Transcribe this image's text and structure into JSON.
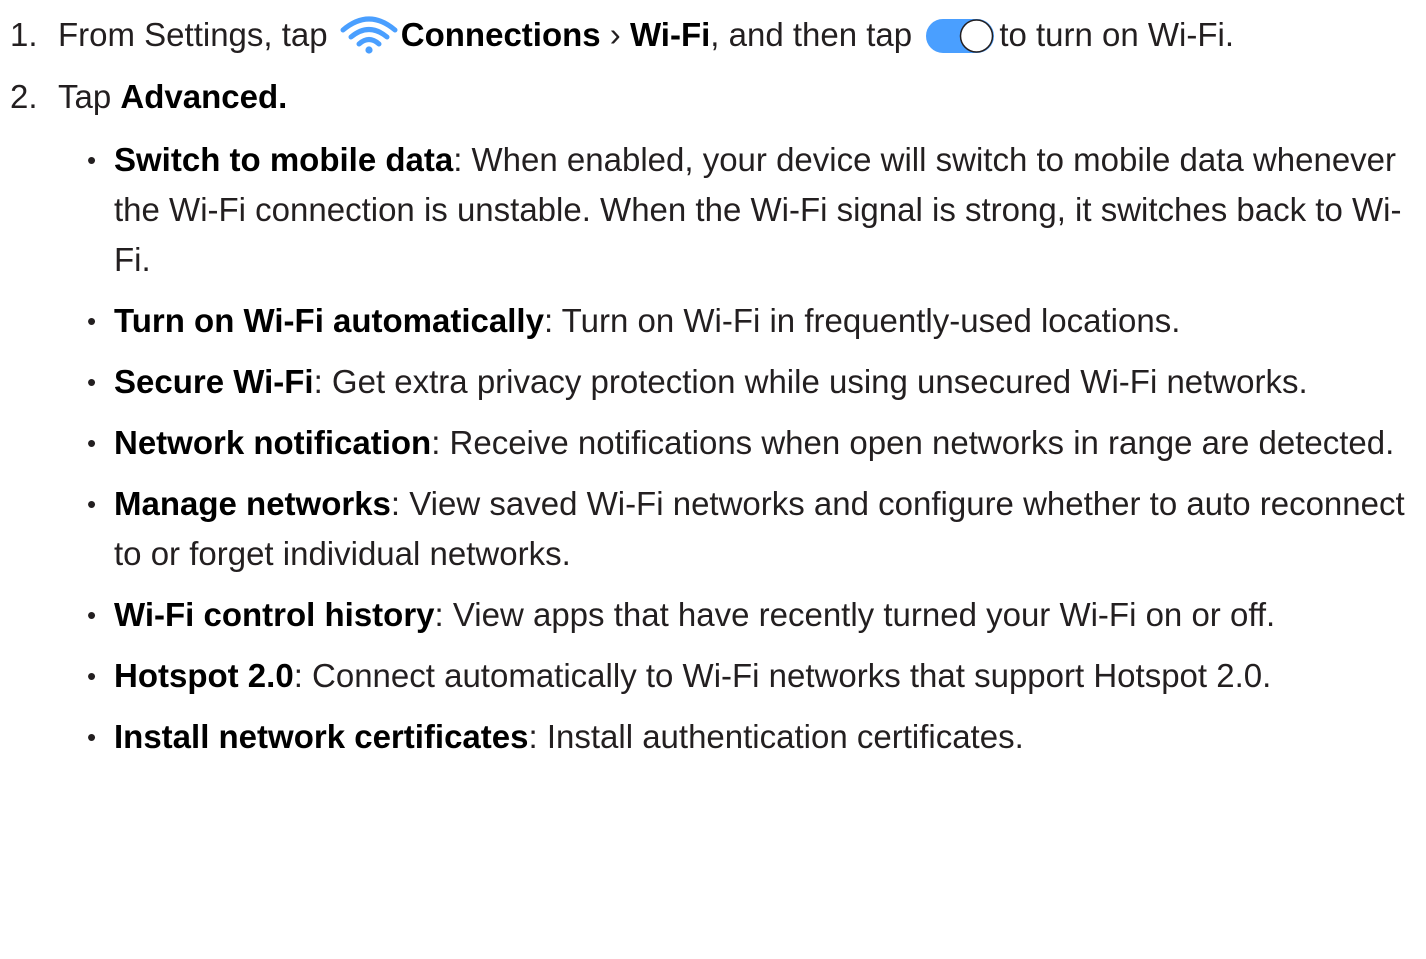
{
  "step1": {
    "number": "1.",
    "text_before": "From Settings, tap",
    "wifi_icon": "wifi-icon",
    "connections_label": "Connections",
    "separator": " › ",
    "wifi_label": "Wi-Fi",
    "text_middle": ", and then tap",
    "toggle_icon": "toggle-switch-icon",
    "text_after": "to turn on Wi-Fi."
  },
  "step2": {
    "number": "2.",
    "text": "Tap",
    "advanced_label": "Advanced."
  },
  "bullets": [
    {
      "term": "Switch to mobile data",
      "description": ": When enabled, your device will switch to mobile data whenever the Wi-Fi connection is unstable. When the Wi-Fi signal is strong, it switches back to Wi-Fi."
    },
    {
      "term": "Turn on Wi-Fi automatically",
      "description": ": Turn on Wi-Fi in frequently-used locations."
    },
    {
      "term": "Secure Wi-Fi",
      "description": ": Get extra privacy protection while using unsecured Wi-Fi networks."
    },
    {
      "term": "Network notification",
      "description": ": Receive notifications when open networks in range are detected."
    },
    {
      "term": "Manage networks",
      "description": ": View saved Wi-Fi networks and configure whether to auto reconnect to or forget individual networks."
    },
    {
      "term": "Wi-Fi control history",
      "description": ": View apps that have recently turned your Wi-Fi on or off."
    },
    {
      "term": "Hotspot 2.0",
      "description": ": Connect automatically to Wi-Fi networks that support Hotspot 2.0."
    },
    {
      "term": "Install network certificates",
      "description": ": Install authentication certificates."
    }
  ],
  "bullet_symbol": "•",
  "colors": {
    "wifi_icon": "#4a9fff",
    "toggle_fill": "#4a9fff",
    "text": "#231f20"
  }
}
